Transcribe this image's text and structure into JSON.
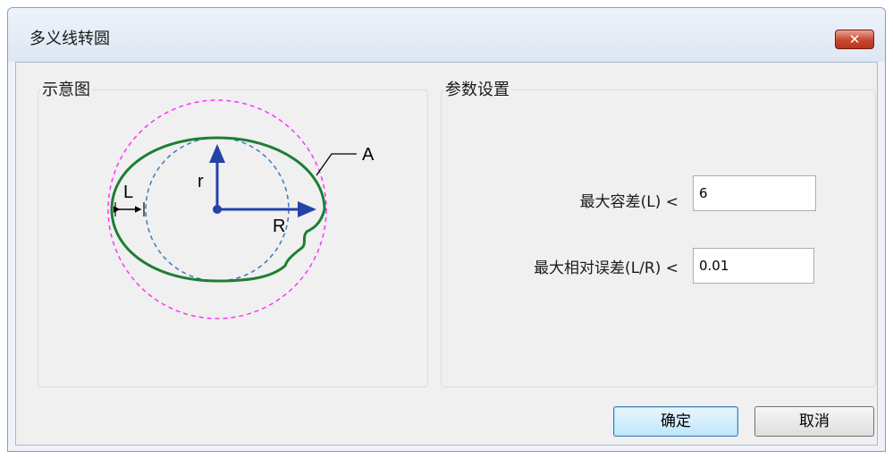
{
  "window": {
    "title": "多义线转圆",
    "close_label": "✕"
  },
  "diagram_group": {
    "title": "示意图",
    "labels": {
      "a": "A",
      "r": "r",
      "big_r": "R",
      "l": "L"
    }
  },
  "params_group": {
    "title": "参数设置",
    "fields": [
      {
        "label": "最大容差(L) <",
        "value": "6"
      },
      {
        "label": "最大相对误差(L/R) <",
        "value": "0.01"
      }
    ]
  },
  "buttons": {
    "ok": "确定",
    "cancel": "取消"
  },
  "colors": {
    "ellipse": "#1e7e34",
    "outer_circle": "#ff33ff",
    "inner_circle": "#3d7ab8",
    "arrows": "#2442a8"
  }
}
